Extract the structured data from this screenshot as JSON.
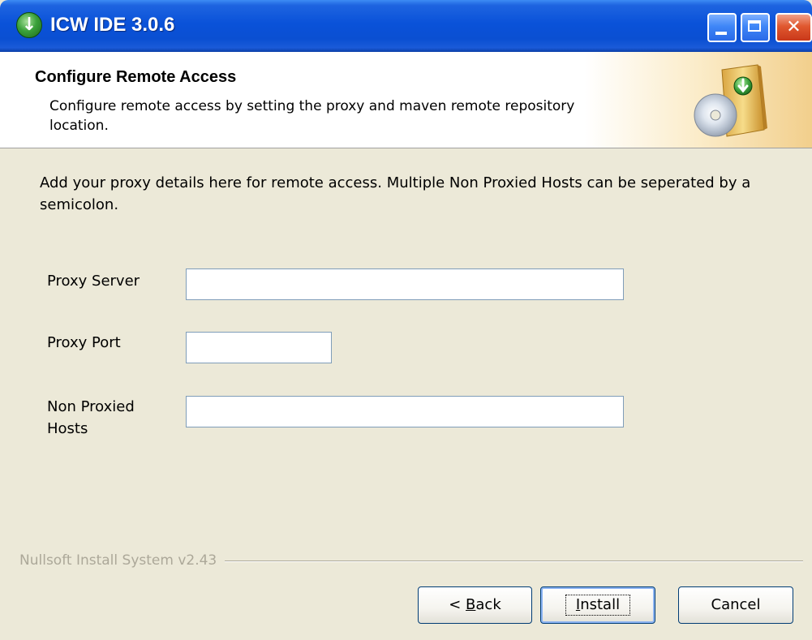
{
  "window": {
    "title": "ICW IDE 3.0.6",
    "controls": {
      "minimize": "minimize",
      "maximize": "maximize",
      "close": "close"
    }
  },
  "header": {
    "title": "Configure Remote Access",
    "description": "Configure remote access by setting the proxy and maven remote repository location."
  },
  "content": {
    "intro": "Add your proxy details here for remote access. Multiple Non Proxied Hosts can be seperated by a semicolon.",
    "fields": {
      "proxy_server": {
        "label": "Proxy Server",
        "value": ""
      },
      "proxy_port": {
        "label": "Proxy Port",
        "value": ""
      },
      "non_proxied_hosts": {
        "label": "Non Proxied Hosts",
        "value": ""
      }
    }
  },
  "footer": {
    "brand": "Nullsoft Install System v2.43",
    "back": {
      "mnemonic": "B",
      "rest": "ack",
      "prefix": "< "
    },
    "install": {
      "mnemonic": "I",
      "rest": "nstall"
    },
    "cancel": {
      "label": "Cancel"
    }
  },
  "icons": {
    "app": "green-download-arrow-icon",
    "header": "installer-box-cd-icon"
  },
  "colors": {
    "titlebar": "#0a4fd2",
    "dialog_bg": "#ece9d8",
    "header_accent": "#f2cf8c",
    "close_button": "#e0582f"
  }
}
